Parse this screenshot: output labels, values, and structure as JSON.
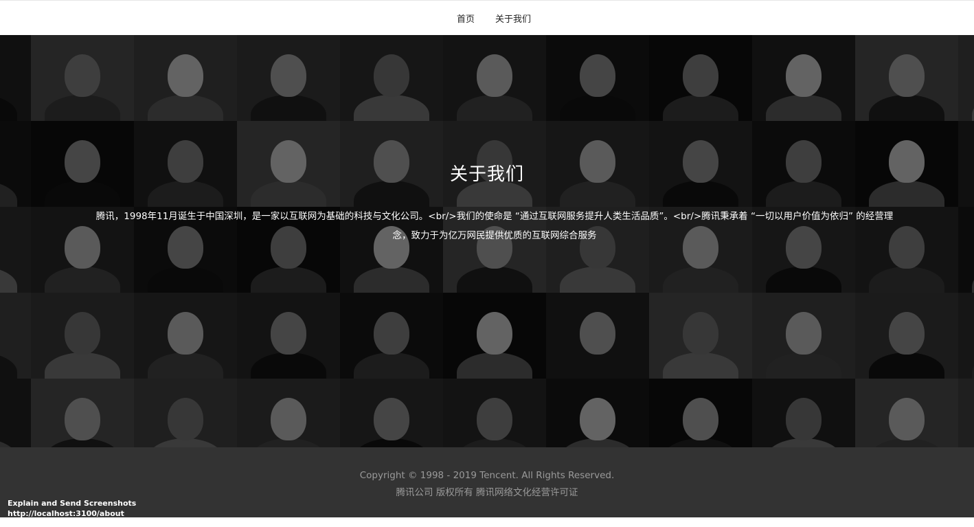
{
  "nav": {
    "items": [
      "首页",
      "关于我们"
    ]
  },
  "hero": {
    "title": "关于我们",
    "description": "腾讯，1998年11月诞生于中国深圳，是一家以互联网为基础的科技与文化公司。<br/>我们的使命是 “通过互联网服务提升人类生活品质”。<br/>腾讯秉承着 “一切以用户价值为依归” 的经营理念，致力于为亿万网民提供优质的互联网综合服务"
  },
  "footer": {
    "copyright": "Copyright © 1998 - 2019 Tencent. All Rights Reserved.",
    "license": "腾讯公司 版权所有 腾讯网络文化经营许可证"
  },
  "overlay_status": {
    "label": "Explain and Send Screenshots",
    "url": "http://localhost:3100/about"
  },
  "colors": {
    "nav_background": "#ffffff",
    "hero_background": "#0a0a0a",
    "footer_background": "#333333",
    "footer_text": "#9a9a9a"
  }
}
